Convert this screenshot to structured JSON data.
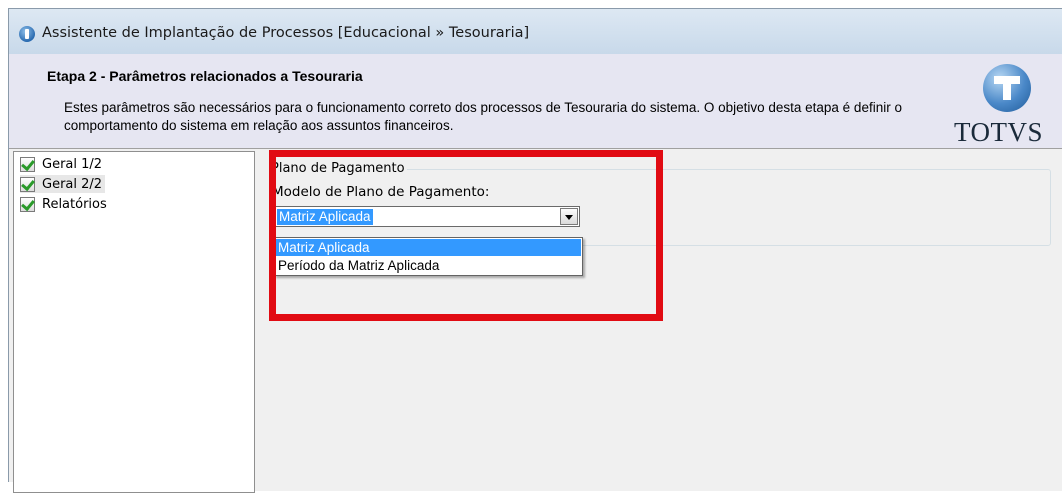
{
  "window": {
    "title": "Assistente de Implantação de Processos [Educacional » Tesouraria]",
    "icon": "app-info-icon"
  },
  "header": {
    "step_title": "Etapa 2 - Parâmetros relacionados a Tesouraria",
    "description": "Estes parâmetros são necessários para o funcionamento correto dos processos de Tesouraria do sistema. O objetivo desta etapa é definir o comportamento do sistema em relação aos assuntos financeiros.",
    "logo_text": "TOTVS"
  },
  "tree": {
    "items": [
      {
        "label": "Geral 1/2",
        "icon": "checklist-icon"
      },
      {
        "label": "Geral 2/2",
        "icon": "checklist-icon"
      },
      {
        "label": "Relatórios",
        "icon": "checklist-icon"
      }
    ],
    "selected": "Geral 2/2"
  },
  "form": {
    "group_title": "Plano de Pagamento",
    "model_label": "Modelo de Plano de Pagamento:",
    "selected_value": "Matriz Aplicada",
    "options": [
      "Matriz Aplicada",
      "Período da Matriz Aplicada"
    ]
  },
  "colors": {
    "highlight_border": "#e10b13",
    "selection": "#3399ff",
    "header_background": "#e6e6f2"
  }
}
